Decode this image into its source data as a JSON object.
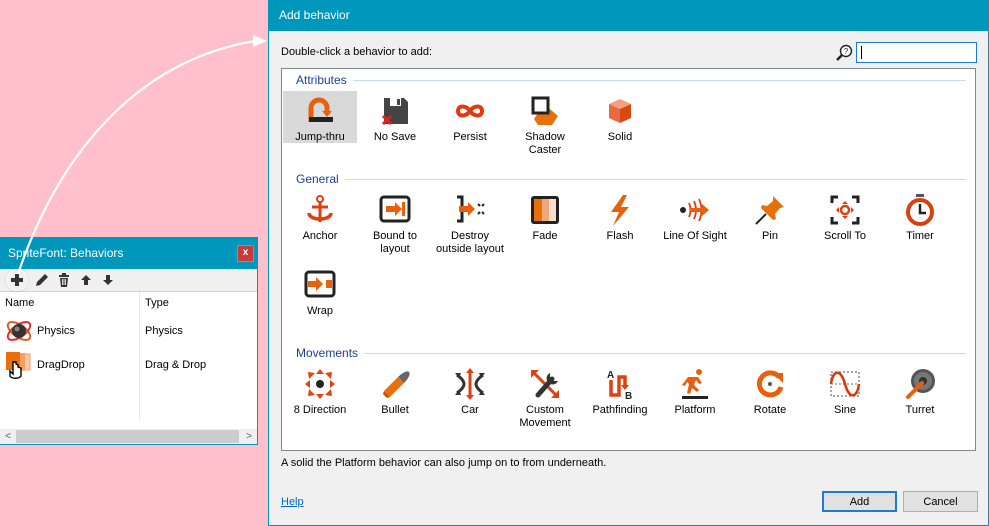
{
  "behaviors_panel": {
    "title": "SpriteFont: Behaviors",
    "close_label": "x",
    "toolbar": [
      "add-icon",
      "edit-icon",
      "delete-icon",
      "move-up-icon",
      "move-down-icon"
    ],
    "columns": [
      "Name",
      "Type"
    ],
    "rows": [
      {
        "name": "Physics",
        "type": "Physics",
        "icon": "physics-icon"
      },
      {
        "name": "DragDrop",
        "type": "Drag & Drop",
        "icon": "dragdrop-icon"
      }
    ],
    "scroll_left": "<",
    "scroll_right": ">"
  },
  "dialog": {
    "title": "Add behavior",
    "instruction": "Double-click a behavior to add:",
    "search": {
      "value": "",
      "placeholder": ""
    },
    "groups": [
      {
        "name": "Attributes",
        "items": [
          {
            "label": "Jump-thru",
            "icon": "jump-thru-icon",
            "selected": true
          },
          {
            "label": "No Save",
            "icon": "no-save-icon"
          },
          {
            "label": "Persist",
            "icon": "persist-icon"
          },
          {
            "label": "Shadow Caster",
            "icon": "shadow-caster-icon"
          },
          {
            "label": "Solid",
            "icon": "solid-icon"
          }
        ]
      },
      {
        "name": "General",
        "items": [
          {
            "label": "Anchor",
            "icon": "anchor-icon"
          },
          {
            "label": "Bound to layout",
            "icon": "bound-to-layout-icon"
          },
          {
            "label": "Destroy outside layout",
            "icon": "destroy-outside-layout-icon"
          },
          {
            "label": "Fade",
            "icon": "fade-icon"
          },
          {
            "label": "Flash",
            "icon": "flash-icon"
          },
          {
            "label": "Line Of Sight",
            "icon": "line-of-sight-icon"
          },
          {
            "label": "Pin",
            "icon": "pin-icon"
          },
          {
            "label": "Scroll To",
            "icon": "scroll-to-icon"
          },
          {
            "label": "Timer",
            "icon": "timer-icon"
          },
          {
            "label": "Wrap",
            "icon": "wrap-icon"
          }
        ]
      },
      {
        "name": "Movements",
        "items": [
          {
            "label": "8 Direction",
            "icon": "eight-direction-icon"
          },
          {
            "label": "Bullet",
            "icon": "bullet-icon"
          },
          {
            "label": "Car",
            "icon": "car-icon"
          },
          {
            "label": "Custom Movement",
            "icon": "custom-movement-icon"
          },
          {
            "label": "Pathfinding",
            "icon": "pathfinding-icon"
          },
          {
            "label": "Platform",
            "icon": "platform-icon"
          },
          {
            "label": "Rotate",
            "icon": "rotate-icon"
          },
          {
            "label": "Sine",
            "icon": "sine-icon"
          },
          {
            "label": "Turret",
            "icon": "turret-icon"
          }
        ]
      }
    ],
    "description": "A solid the Platform behavior can also jump on to from underneath.",
    "help_label": "Help",
    "add_label": "Add",
    "cancel_label": "Cancel"
  },
  "colors": {
    "titlebar": "#0097bd",
    "background": "#ffc0cb",
    "accent_orange": "#e8600c",
    "group_header": "#1e3f9a"
  }
}
